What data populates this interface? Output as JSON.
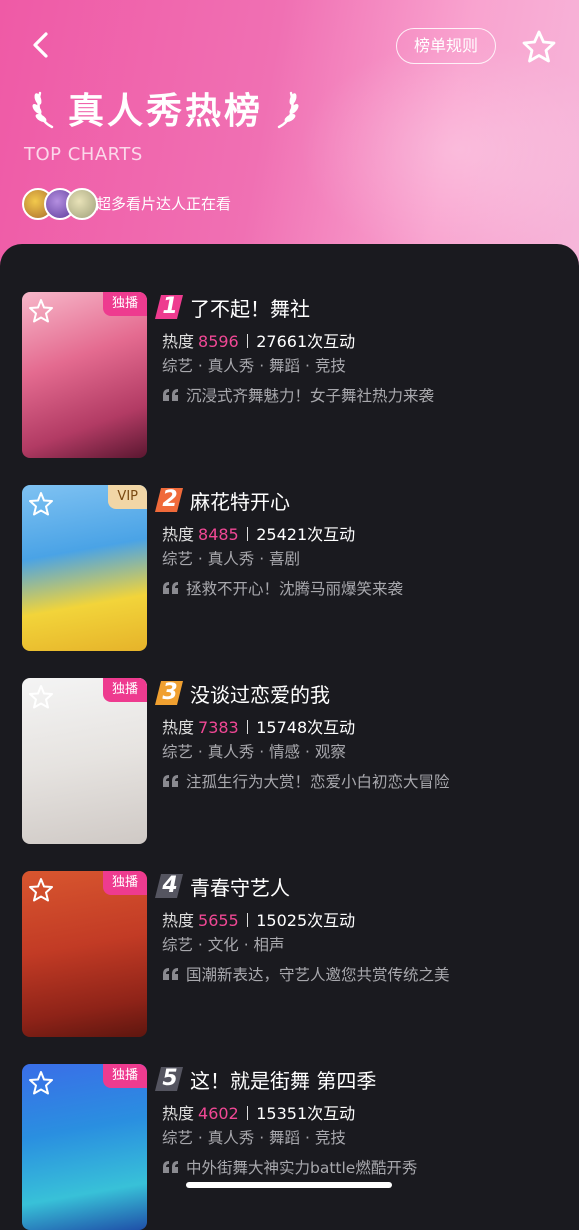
{
  "header": {
    "title": "真人秀热榜",
    "subtitle": "TOP CHARTS",
    "rules_label": "榜单规则",
    "viewers_text": "超多看片达人正在看"
  },
  "colors": {
    "accent": "#ee3b8f",
    "heat": "#f04895",
    "rank1": "#ee3b8f",
    "rank2": "#f06a3a",
    "rank3": "#f0a030",
    "rank_other": "#555560"
  },
  "shows": [
    {
      "rank": "1",
      "title": "了不起！舞社",
      "badge": "独播",
      "heat_label": "热度",
      "heat": "8596",
      "interactions": "27661次互动",
      "tags": "综艺 · 真人秀 · 舞蹈 · 竞技",
      "desc": "沉浸式齐舞魅力！女子舞社热力来袭"
    },
    {
      "rank": "2",
      "title": "麻花特开心",
      "badge": "VIP",
      "heat_label": "热度",
      "heat": "8485",
      "interactions": "25421次互动",
      "tags": "综艺 · 真人秀 · 喜剧",
      "desc": "拯救不开心！沈腾马丽爆笑来袭"
    },
    {
      "rank": "3",
      "title": "没谈过恋爱的我",
      "badge": "独播",
      "heat_label": "热度",
      "heat": "7383",
      "interactions": "15748次互动",
      "tags": "综艺 · 真人秀 · 情感 · 观察",
      "desc": "注孤生行为大赏！恋爱小白初恋大冒险"
    },
    {
      "rank": "4",
      "title": "青春守艺人",
      "badge": "独播",
      "heat_label": "热度",
      "heat": "5655",
      "interactions": "15025次互动",
      "tags": "综艺 · 文化 · 相声",
      "desc": "国潮新表达，守艺人邀您共赏传统之美"
    },
    {
      "rank": "5",
      "title": "这！就是街舞 第四季",
      "badge": "独播",
      "heat_label": "热度",
      "heat": "4602",
      "interactions": "15351次互动",
      "tags": "综艺 · 真人秀 · 舞蹈 · 竞技",
      "desc": "中外街舞大神实力battle燃酷开秀"
    }
  ]
}
